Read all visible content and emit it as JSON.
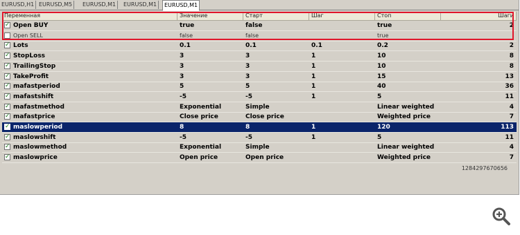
{
  "tabs": [
    "EURUSD,H1",
    "EURUSD,M5",
    "EURUSD,M1",
    "EURUSD,M1",
    "EURUSD,M1"
  ],
  "active_tab": 4,
  "columns": [
    "Переменная",
    "Значение",
    "Старт",
    "Шаг",
    "Стоп",
    "Шаги"
  ],
  "rows": [
    {
      "name": "Open BUY",
      "checked": true,
      "value": "true",
      "start": "false",
      "step": "",
      "stop": "true",
      "steps": "2"
    },
    {
      "name": "Open SELL",
      "checked": false,
      "value": "false",
      "start": "false",
      "step": "",
      "stop": "true",
      "steps": ""
    },
    {
      "name": "Lots",
      "checked": true,
      "value": "0.1",
      "start": "0.1",
      "step": "0.1",
      "stop": "0.2",
      "steps": "2"
    },
    {
      "name": "StopLoss",
      "checked": true,
      "value": "3",
      "start": "3",
      "step": "1",
      "stop": "10",
      "steps": "8"
    },
    {
      "name": "TrailingStop",
      "checked": true,
      "value": "3",
      "start": "3",
      "step": "1",
      "stop": "10",
      "steps": "8"
    },
    {
      "name": "TakeProfit",
      "checked": true,
      "value": "3",
      "start": "3",
      "step": "1",
      "stop": "15",
      "steps": "13"
    },
    {
      "name": "mafastperiod",
      "checked": true,
      "value": "5",
      "start": "5",
      "step": "1",
      "stop": "40",
      "steps": "36"
    },
    {
      "name": "mafastshift",
      "checked": true,
      "value": "-5",
      "start": "-5",
      "step": "1",
      "stop": "5",
      "steps": "11"
    },
    {
      "name": "mafastmethod",
      "checked": true,
      "value": "Exponential",
      "start": "Simple",
      "step": "",
      "stop": "Linear weighted",
      "steps": "4"
    },
    {
      "name": "mafastprice",
      "checked": true,
      "value": "Close price",
      "start": "Close price",
      "step": "",
      "stop": "Weighted price",
      "steps": "7"
    },
    {
      "name": "maslowperiod",
      "checked": true,
      "value": "8",
      "start": "8",
      "step": "1",
      "stop": "120",
      "steps": "113"
    },
    {
      "name": "maslowshift",
      "checked": true,
      "value": "-5",
      "start": "-5",
      "step": "1",
      "stop": "5",
      "steps": "11"
    },
    {
      "name": "maslowmethod",
      "checked": true,
      "value": "Exponential",
      "start": "Simple",
      "step": "",
      "stop": "Linear weighted",
      "steps": "4"
    },
    {
      "name": "maslowprice",
      "checked": true,
      "value": "Open price",
      "start": "Open price",
      "step": "",
      "stop": "Weighted price",
      "steps": "7"
    }
  ],
  "selected_row": 10,
  "highlighted_rows": [
    0,
    1
  ],
  "total_passes": "1284297670656",
  "colors": {
    "highlight_border": "#e0162b",
    "selection": "#0a246a",
    "check": "#1a7a1a"
  },
  "zoom_icon": "zoom-in-icon"
}
